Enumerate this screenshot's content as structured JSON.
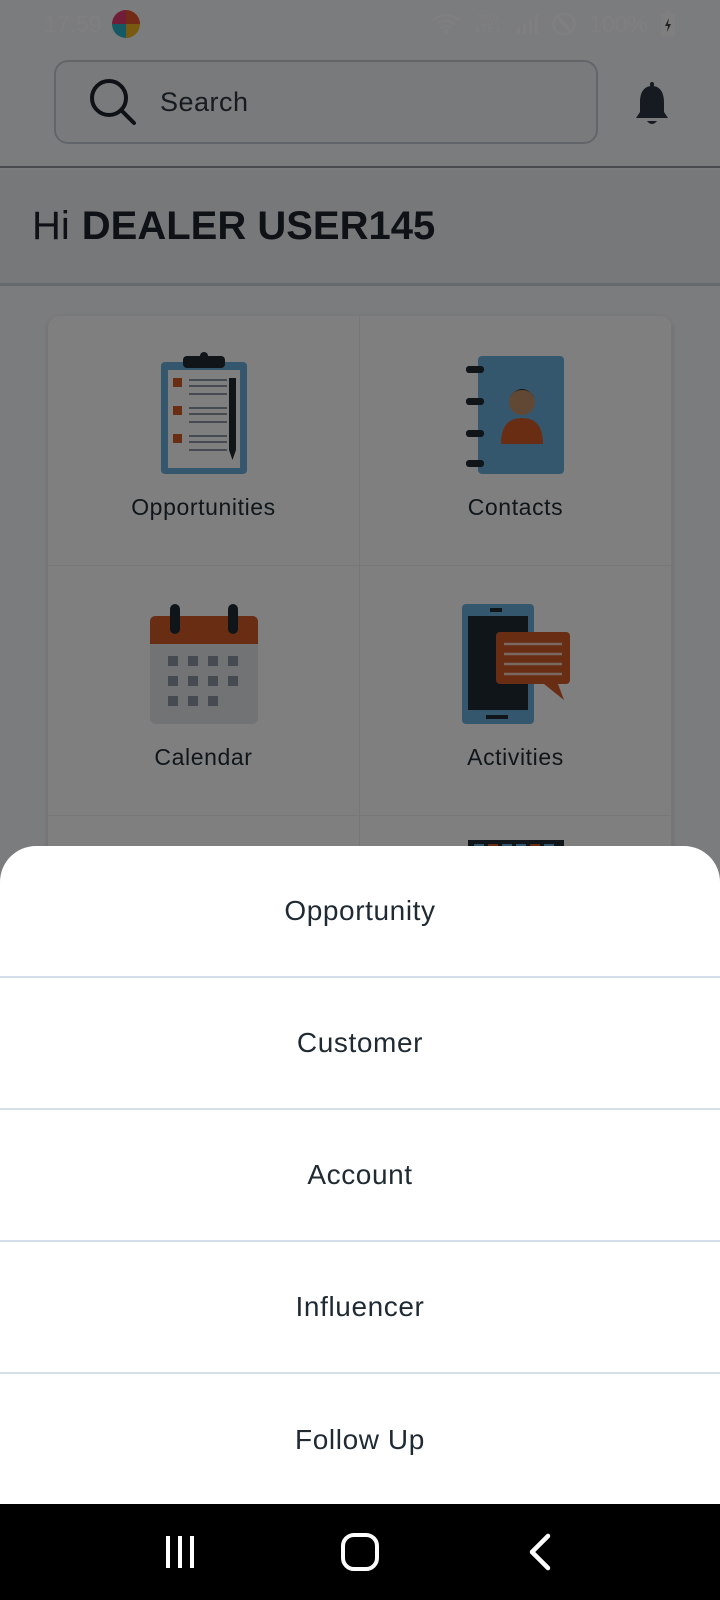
{
  "status": {
    "time": "17:59",
    "battery": "100%",
    "network": "Vo)) LTE1"
  },
  "search": {
    "placeholder": "Search"
  },
  "greeting": {
    "hi": "Hi",
    "user": "DEALER USER145"
  },
  "tiles": [
    {
      "label": "Opportunities",
      "icon": "clipboard-icon"
    },
    {
      "label": "Contacts",
      "icon": "contact-book-icon"
    },
    {
      "label": "Calendar",
      "icon": "calendar-icon"
    },
    {
      "label": "Activities",
      "icon": "phone-chat-icon"
    }
  ],
  "sheet": {
    "items": [
      {
        "label": "Opportunity"
      },
      {
        "label": "Customer"
      },
      {
        "label": "Account"
      },
      {
        "label": "Influencer"
      },
      {
        "label": "Follow Up"
      }
    ]
  },
  "colors": {
    "accent": "#d35a26",
    "icon_blue": "#6aaedc",
    "dark": "#1f2a33"
  }
}
